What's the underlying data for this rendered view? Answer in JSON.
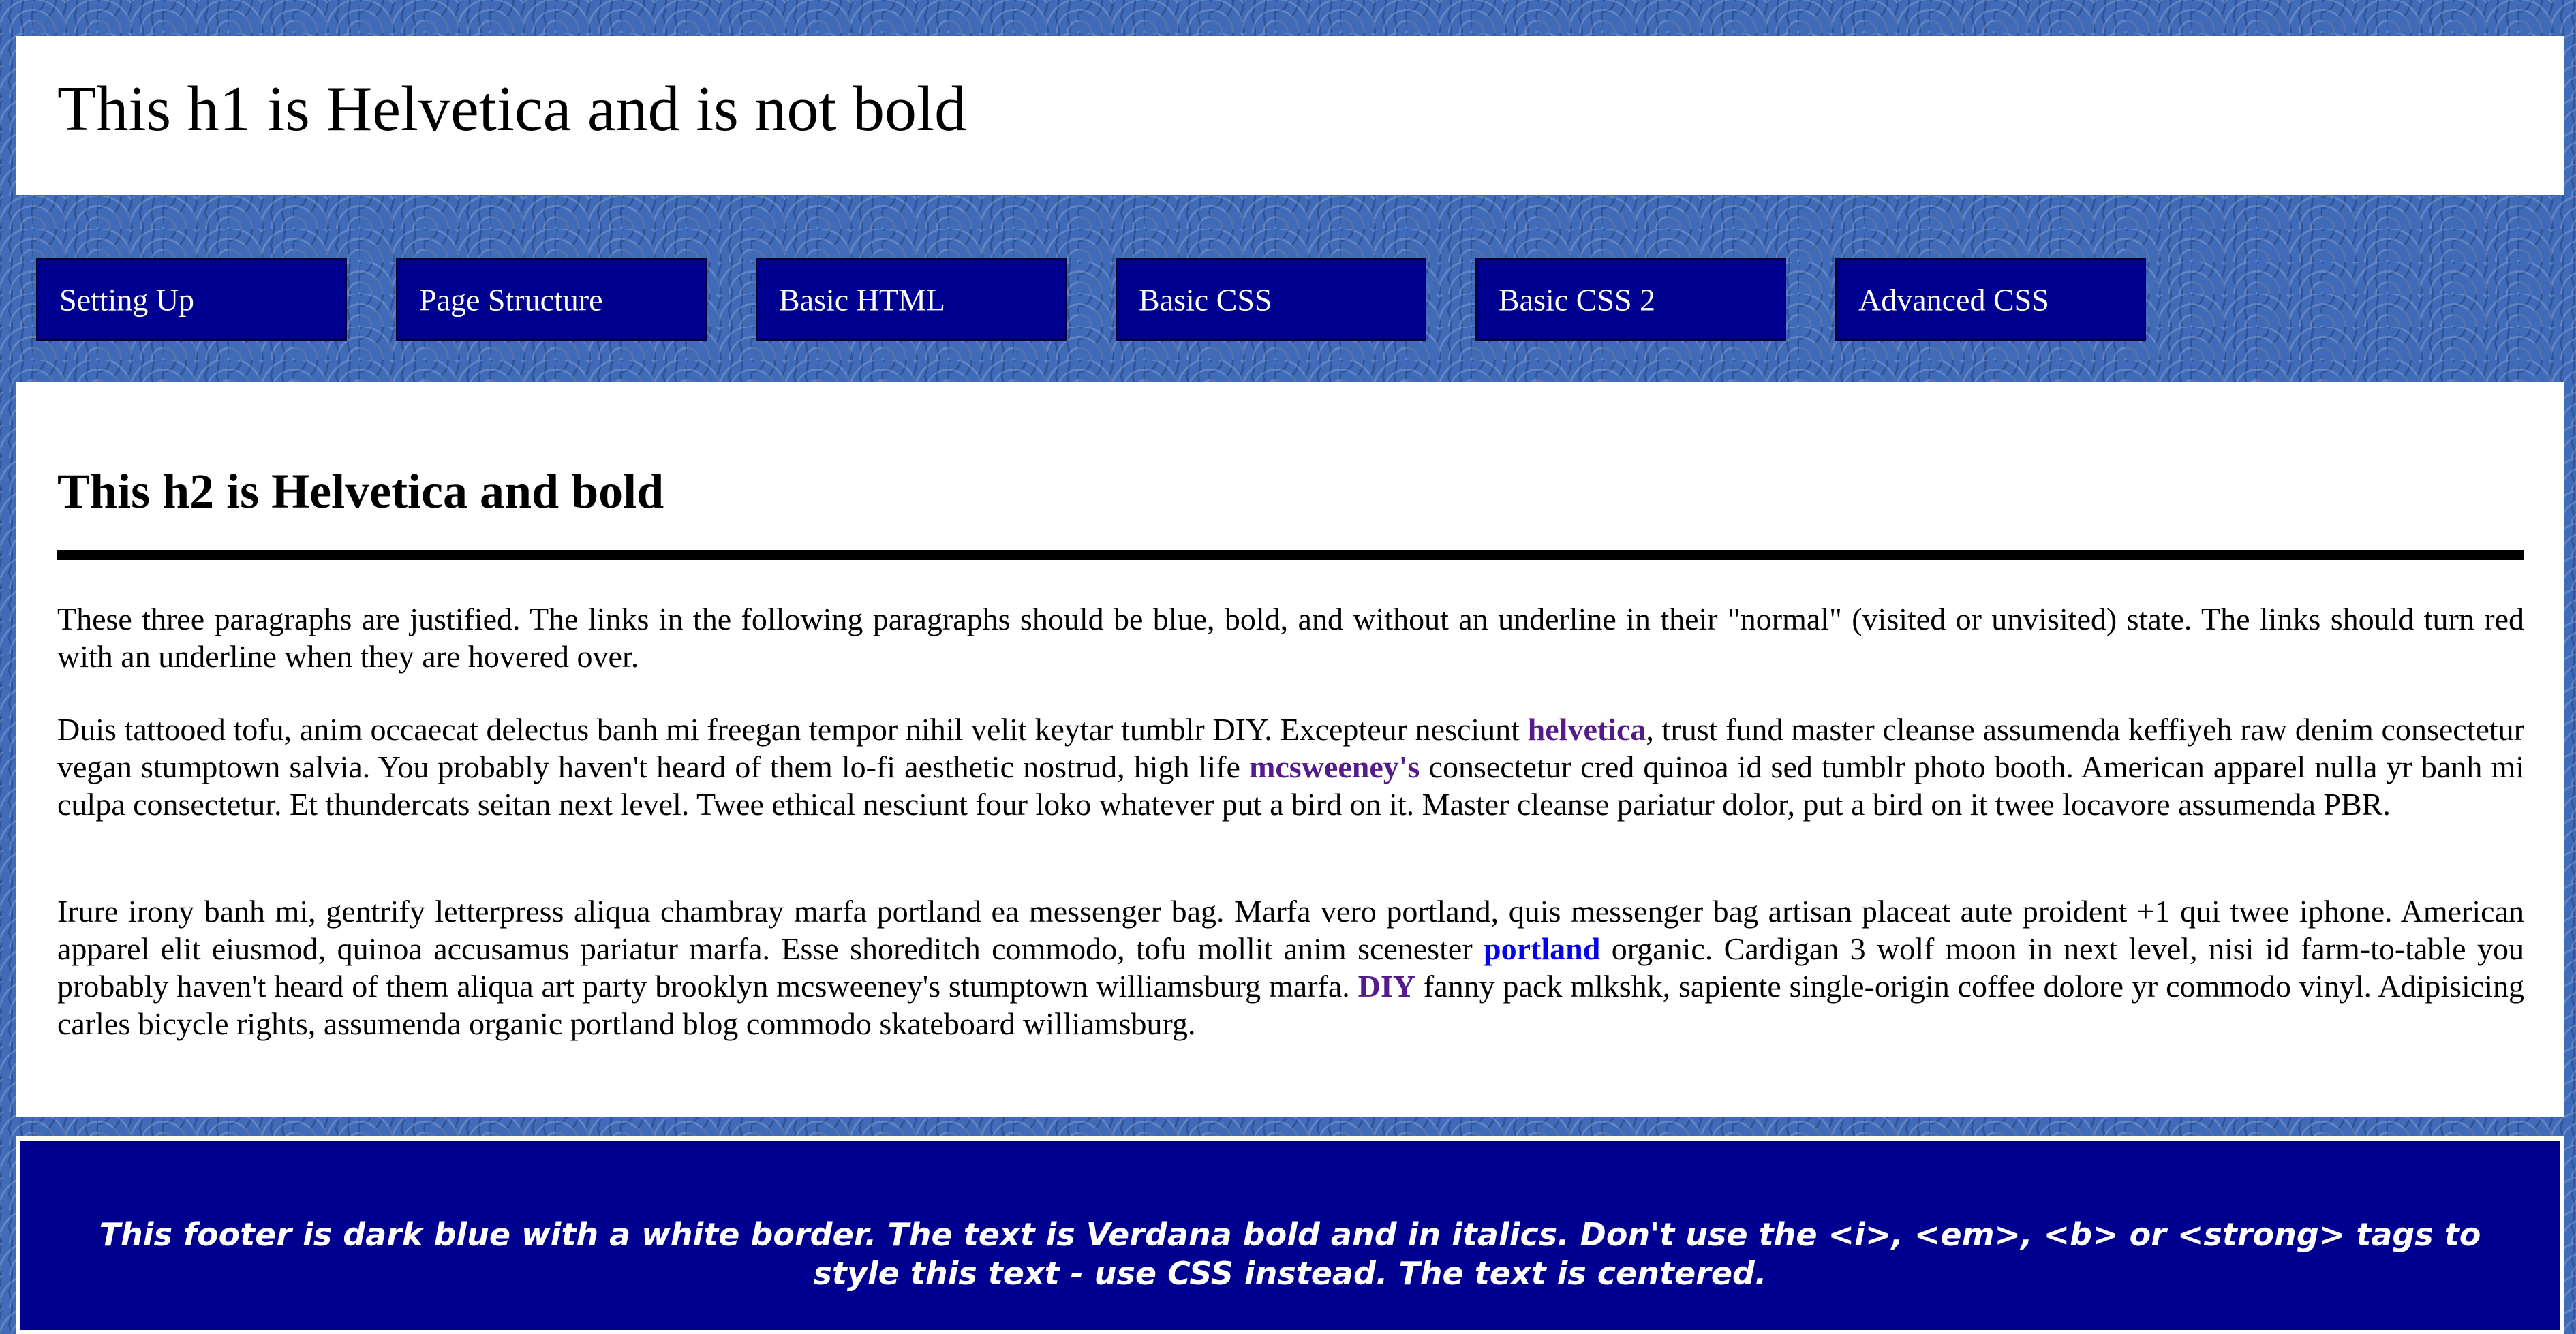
{
  "header": {
    "title": "This h1 is Helvetica and is not bold"
  },
  "nav": {
    "items": [
      {
        "label": "Setting Up"
      },
      {
        "label": "Page Structure"
      },
      {
        "label": "Basic HTML"
      },
      {
        "label": "Basic CSS"
      },
      {
        "label": "Basic CSS 2"
      },
      {
        "label": "Advanced CSS"
      }
    ]
  },
  "main": {
    "heading": "This h2 is Helvetica and bold",
    "p1": {
      "text": "These three paragraphs are justified. The links in the following paragraphs should be blue, bold, and without an underline in their \"normal\" (visited or unvisited) state. The links should turn red with an underline when they are hovered over."
    },
    "p2": {
      "t1": "Duis tattooed tofu, anim occaecat delectus banh mi freegan tempor nihil velit keytar tumblr DIY. Excepteur nesciunt ",
      "link1": "helvetica",
      "t2": ", trust fund master cleanse assumenda keffiyeh raw denim consectetur vegan stumptown salvia. You probably haven't heard of them lo-fi aesthetic nostrud, high life ",
      "link2": "mcsweeney's",
      "t3": " consectetur cred quinoa id sed tumblr photo booth. American apparel nulla yr banh mi culpa consectetur. Et thundercats seitan next level. Twee ethical nesciunt four loko whatever put a bird on it. Master cleanse pariatur dolor, put a bird on it twee locavore assumenda PBR."
    },
    "p3": {
      "t1": "Irure irony banh mi, gentrify letterpress aliqua chambray marfa portland ea messenger bag. Marfa vero portland, quis messenger bag artisan placeat aute proident +1 qui twee iphone. American apparel elit eiusmod, quinoa accusamus pariatur marfa. Esse shoreditch commodo, tofu mollit anim scenester ",
      "link1": "portland",
      "t2": " organic. Cardigan 3 wolf moon in next level, nisi id farm-to-table you probably haven't heard of them aliqua art party brooklyn mcsweeney's stumptown williamsburg marfa. ",
      "link2": "DIY",
      "t3": " fanny pack mlkshk, sapiente single-origin coffee dolore yr commodo vinyl. Adipisicing carles bicycle rights, assumenda organic portland blog commodo skateboard williamsburg."
    }
  },
  "footer": {
    "text": "This footer is dark blue with a white border. The text is Verdana bold and in italics. Don't use the <i>, <em>, <b> or <strong> tags to style this text - use CSS instead. The text is centered."
  },
  "colors": {
    "nav_bg": "#000090",
    "footer_bg": "#000090",
    "visited_link": "#551a8b",
    "unvisited_link": "#0000ee",
    "page_pattern": "#3f6bb8"
  }
}
